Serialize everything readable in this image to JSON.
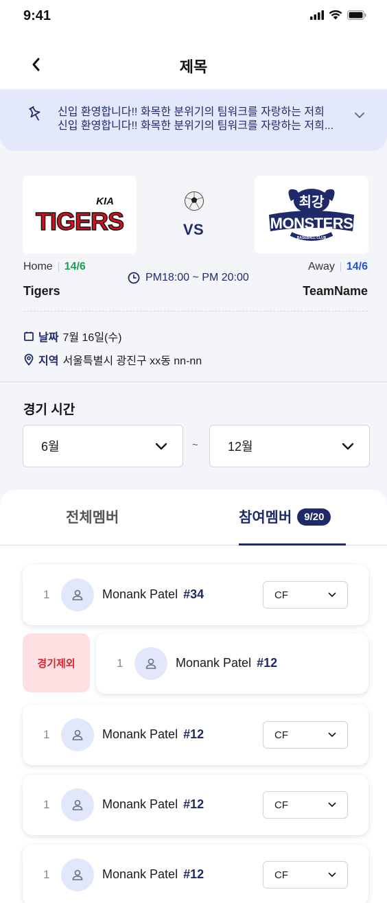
{
  "status": {
    "time": "9:41"
  },
  "header": {
    "title": "제목"
  },
  "notice": {
    "line1": "신입 환영합니다!! 화목한 분위기의 팀워크를 자랑하는 저희",
    "line2": "신입 환영합니다!! 화목한 분위기의 팀워크를 자랑하는 저희..."
  },
  "match": {
    "home": {
      "label": "Home",
      "score": "14/6",
      "name": "Tigers",
      "logo_text": "TIGERS",
      "logo_brand": "KIA"
    },
    "away": {
      "label": "Away",
      "score": "14/6",
      "name": "TeamName",
      "logo_text": "MONSTERS",
      "logo_top": "최강",
      "logo_bottom": "BASEBALL CLUB"
    },
    "vs": "VS",
    "time": "PM18:00 ~ PM 20:00",
    "date_label": "날짜",
    "date_value": "7월 16일(수)",
    "place_label": "지역",
    "place_value": "서울특별시 광진구 xx동 nn-nn"
  },
  "game_time": {
    "title": "경기 시간",
    "from": "6월",
    "separator": "~",
    "to": "12월"
  },
  "tabs": {
    "all": "전체멤버",
    "joined": "참여멤버",
    "joined_badge": "9/20"
  },
  "members": [
    {
      "num": "1",
      "name": "Monank Patel",
      "no": "#34",
      "position": "CF"
    },
    {
      "num": "1",
      "name": "Monank Patel",
      "no": "#12",
      "excluded_label": "경기제외"
    },
    {
      "num": "1",
      "name": "Monank Patel",
      "no": "#12",
      "position": "CF"
    },
    {
      "num": "1",
      "name": "Monank Patel",
      "no": "#12",
      "position": "CF"
    },
    {
      "num": "1",
      "name": "Monank Patel",
      "no": "#12",
      "position": "CF"
    }
  ],
  "colors": {
    "navy": "#1f2a6b",
    "green": "#1aa050",
    "blue": "#2451d6",
    "red": "#e0202e"
  }
}
